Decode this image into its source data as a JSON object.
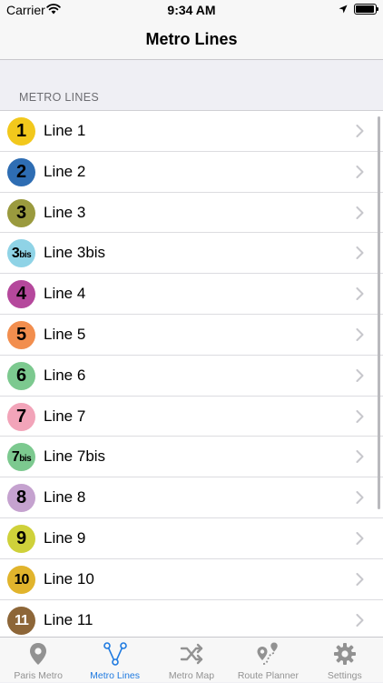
{
  "status_bar": {
    "carrier": "Carrier",
    "time": "9:34 AM"
  },
  "nav": {
    "title": "Metro Lines"
  },
  "section": {
    "header": "METRO LINES"
  },
  "lines": [
    {
      "num": "1",
      "suffix": "",
      "label": "Line 1",
      "color": "#f2c81c"
    },
    {
      "num": "2",
      "suffix": "",
      "label": "Line 2",
      "color": "#2e6db3"
    },
    {
      "num": "3",
      "suffix": "",
      "label": "Line 3",
      "color": "#9a9a3e"
    },
    {
      "num": "3",
      "suffix": "bis",
      "label": "Line 3bis",
      "color": "#8fd3e6"
    },
    {
      "num": "4",
      "suffix": "",
      "label": "Line 4",
      "color": "#b5489c"
    },
    {
      "num": "5",
      "suffix": "",
      "label": "Line 5",
      "color": "#f28e4e"
    },
    {
      "num": "6",
      "suffix": "",
      "label": "Line 6",
      "color": "#7cc98f"
    },
    {
      "num": "7",
      "suffix": "",
      "label": "Line 7",
      "color": "#f2a4b9"
    },
    {
      "num": "7",
      "suffix": "bis",
      "label": "Line 7bis",
      "color": "#7cc98f"
    },
    {
      "num": "8",
      "suffix": "",
      "label": "Line 8",
      "color": "#c5a2cf"
    },
    {
      "num": "9",
      "suffix": "",
      "label": "Line 9",
      "color": "#cfd13a"
    },
    {
      "num": "10",
      "suffix": "",
      "label": "Line 10",
      "color": "#e1b42c"
    },
    {
      "num": "11",
      "suffix": "",
      "label": "Line 11",
      "color": "#8d6638"
    }
  ],
  "tabbar": {
    "tabs": [
      {
        "label": "Paris Metro",
        "icon": "map-pin-icon",
        "active": false
      },
      {
        "label": "Metro Lines",
        "icon": "network-icon",
        "active": true
      },
      {
        "label": "Metro Map",
        "icon": "shuffle-icon",
        "active": false
      },
      {
        "label": "Route Planner",
        "icon": "route-icon",
        "active": false
      },
      {
        "label": "Settings",
        "icon": "gear-icon",
        "active": false
      }
    ]
  },
  "colors": {
    "accent": "#1f7ae0",
    "inactive": "#929292"
  }
}
